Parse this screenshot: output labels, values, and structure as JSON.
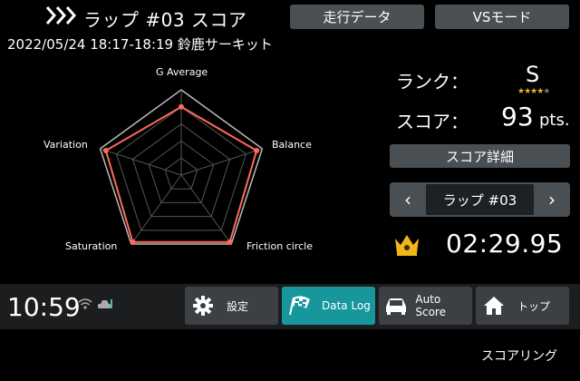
{
  "header": {
    "title": "ラップ #03 スコア",
    "tab_running_data": "走行データ",
    "tab_vs_mode": "VSモード"
  },
  "session": "2022/05/24 18:17-18:19 鈴鹿サーキット",
  "radar": {
    "axes": [
      "G Average",
      "Balance",
      "Friction circle",
      "Saturation",
      "Variation"
    ],
    "levels": 5,
    "values": [
      0.8,
      0.93,
      0.97,
      0.97,
      0.93
    ],
    "line_color": "#ff6a5a"
  },
  "score_panel": {
    "rank_label": "ランク：",
    "rank_value": "S",
    "stars": "★★★★★",
    "score_label": "スコア：",
    "score_value": "93",
    "score_unit": "pts.",
    "detail_button": "スコア詳細",
    "lap_prev": "‹",
    "lap_label": "ラップ #03",
    "lap_next": "›",
    "lap_time": "02:29.95"
  },
  "status": {
    "clock": "10:59"
  },
  "nav": {
    "settings": "設定",
    "data_log": "Data Log",
    "auto_score": "Auto Score",
    "top": "トップ",
    "active_color": "#17979b"
  },
  "footer": "スコアリング"
}
